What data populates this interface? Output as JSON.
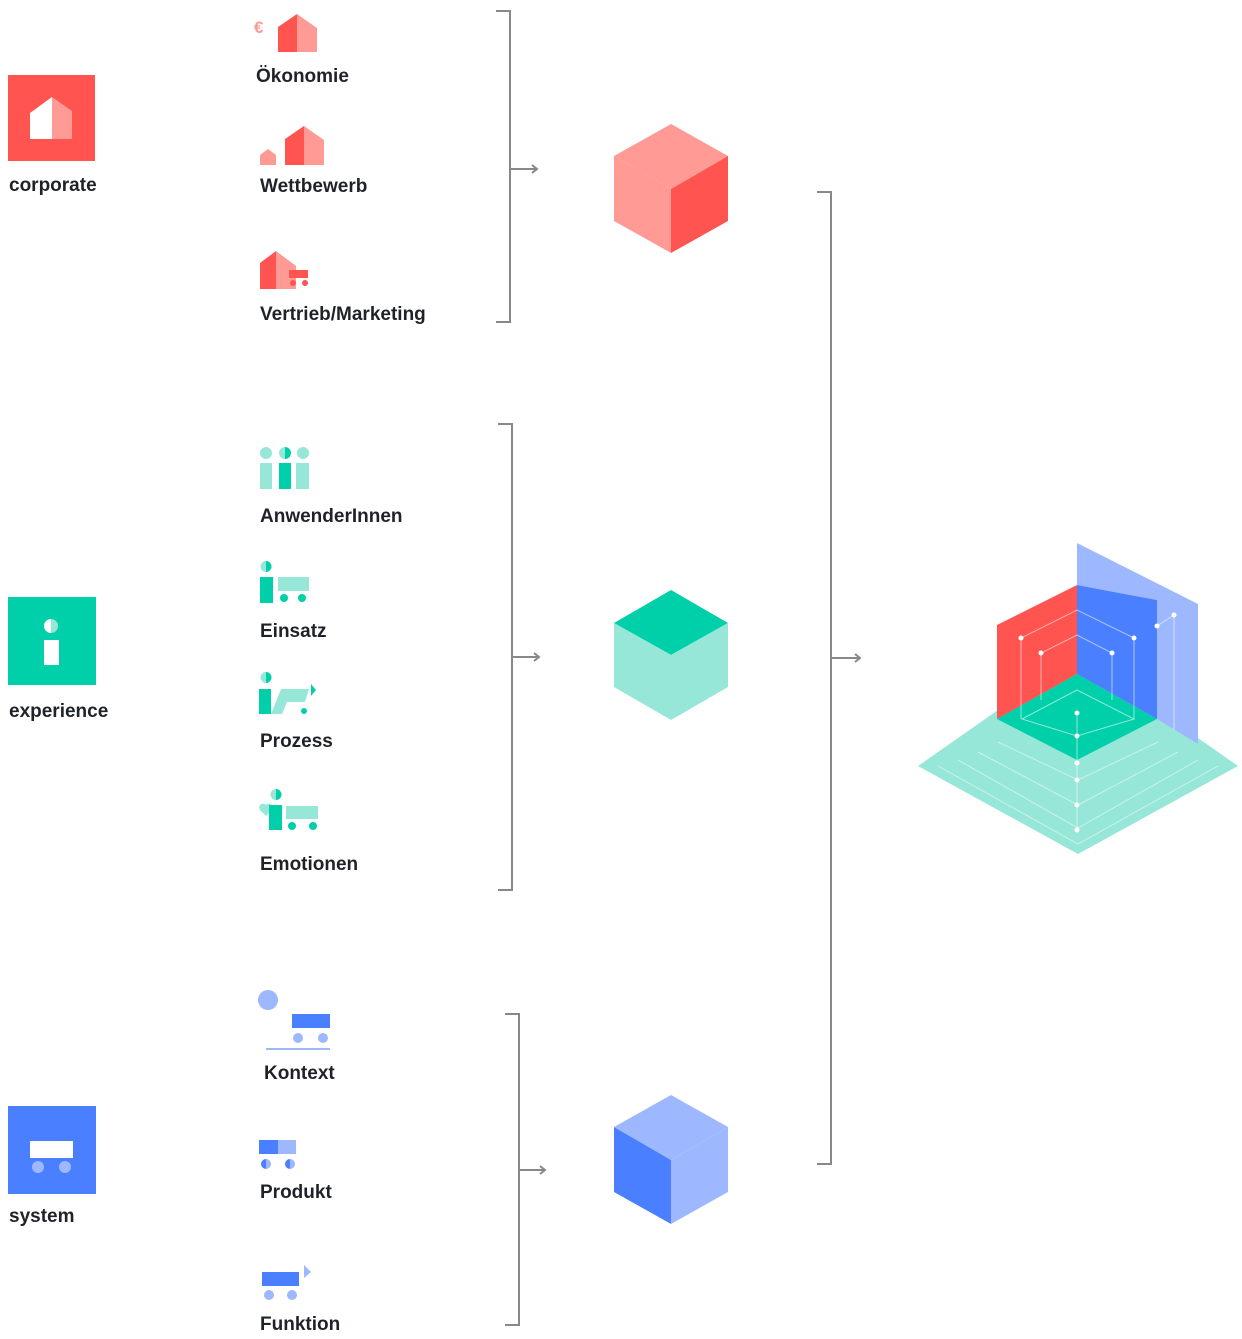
{
  "colors": {
    "red": "#ff5450",
    "red_light": "#ff9a94",
    "teal": "#00d0aa",
    "teal_light": "#97e7d8",
    "blue": "#4a80ff",
    "blue_light": "#9db8ff",
    "bracket": "#888888"
  },
  "groups": [
    {
      "label": "corporate",
      "icon": "house-icon",
      "color": "#ff5450",
      "items": [
        {
          "label": "Ökonomie",
          "icon": "euro-house-icon"
        },
        {
          "label": "Wettbewerb",
          "icon": "two-houses-icon"
        },
        {
          "label": "Vertrieb/Marketing",
          "icon": "house-truck-icon"
        }
      ],
      "result": "red-cube-icon"
    },
    {
      "label": "experience",
      "icon": "info-icon",
      "color": "#00d0aa",
      "items": [
        {
          "label": "AnwenderInnen",
          "icon": "users-icon"
        },
        {
          "label": "Einsatz",
          "icon": "user-cart-icon"
        },
        {
          "label": "Prozess",
          "icon": "user-process-icon"
        },
        {
          "label": "Emotionen",
          "icon": "user-heart-cart-icon"
        }
      ],
      "result": "teal-cube-icon"
    },
    {
      "label": "system",
      "icon": "cart-icon",
      "color": "#4a80ff",
      "items": [
        {
          "label": "Kontext",
          "icon": "sun-cart-icon"
        },
        {
          "label": "Produkt",
          "icon": "split-cart-icon"
        },
        {
          "label": "Funktion",
          "icon": "cart-arrow-icon"
        }
      ],
      "result": "blue-cube-icon"
    }
  ],
  "final_result": "isometric-space-icon"
}
